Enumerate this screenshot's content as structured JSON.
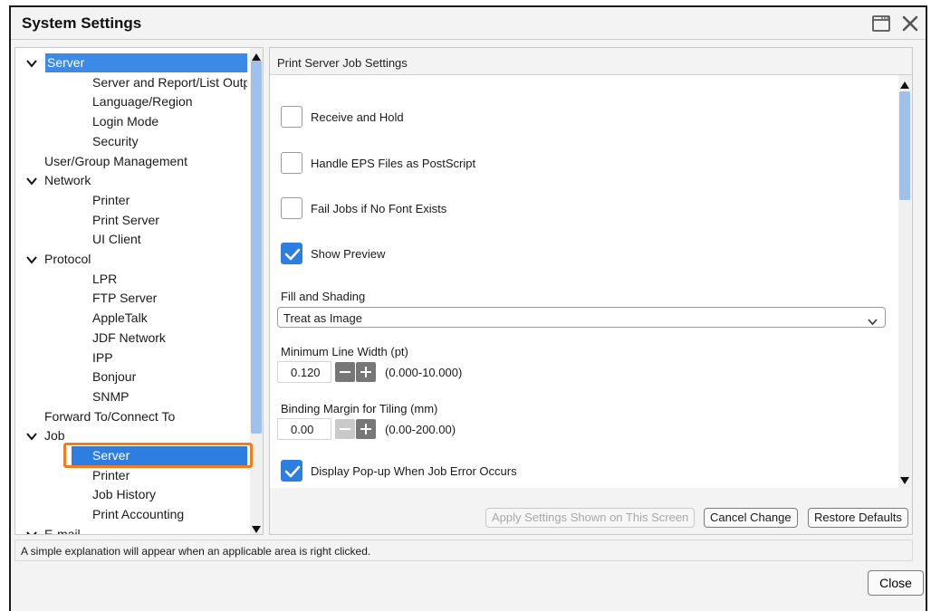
{
  "window": {
    "title": "System Settings"
  },
  "tree": {
    "items": [
      {
        "label": "Server",
        "level": 0,
        "expanded": true,
        "selected": true
      },
      {
        "label": "Server and Report/List Output",
        "level": 1
      },
      {
        "label": "Language/Region",
        "level": 1
      },
      {
        "label": "Login Mode",
        "level": 1
      },
      {
        "label": "Security",
        "level": 1
      },
      {
        "label": "User/Group Management",
        "level": 0
      },
      {
        "label": "Network",
        "level": 0,
        "expanded": true
      },
      {
        "label": "Printer",
        "level": 1
      },
      {
        "label": "Print Server",
        "level": 1
      },
      {
        "label": "UI Client",
        "level": 1
      },
      {
        "label": "Protocol",
        "level": 0,
        "expanded": true
      },
      {
        "label": "LPR",
        "level": 1
      },
      {
        "label": "FTP Server",
        "level": 1
      },
      {
        "label": "AppleTalk",
        "level": 1
      },
      {
        "label": "JDF Network",
        "level": 1
      },
      {
        "label": "IPP",
        "level": 1
      },
      {
        "label": "Bonjour",
        "level": 1
      },
      {
        "label": "SNMP",
        "level": 1
      },
      {
        "label": "Forward To/Connect To",
        "level": 0
      },
      {
        "label": "Job",
        "level": 0,
        "expanded": true
      },
      {
        "label": "Server",
        "level": 1,
        "selected": true
      },
      {
        "label": "Printer",
        "level": 1
      },
      {
        "label": "Job History",
        "level": 1
      },
      {
        "label": "Print Accounting",
        "level": 1
      },
      {
        "label": "E-mail",
        "level": 0,
        "expanded": true
      }
    ]
  },
  "panel": {
    "header": "Print Server Job Settings",
    "checkboxes": [
      {
        "label": "Receive and Hold",
        "checked": false
      },
      {
        "label": "Handle EPS Files as PostScript",
        "checked": false
      },
      {
        "label": "Fail Jobs if No Font Exists",
        "checked": false
      },
      {
        "label": "Show Preview",
        "checked": true
      },
      {
        "label": "Display Pop-up When Job Error Occurs",
        "checked": true
      }
    ],
    "fill_shading": {
      "label": "Fill and Shading",
      "value": "Treat as Image"
    },
    "min_line_width": {
      "label": "Minimum Line Width (pt)",
      "value": "0.120",
      "range": "(0.000-10.000)"
    },
    "binding_margin": {
      "label": "Binding Margin for Tiling (mm)",
      "value": "0.00",
      "range": "(0.00-200.00)"
    }
  },
  "buttons": {
    "apply": "Apply Settings Shown on This Screen",
    "cancel": "Cancel Change",
    "restore": "Restore Defaults",
    "close": "Close"
  },
  "status": "A simple explanation will appear when an applicable area is right clicked.",
  "colors": {
    "selection": "#2e7de0",
    "highlight_outline": "#ef7d1a",
    "scroll_thumb": "#9fc0ea"
  }
}
